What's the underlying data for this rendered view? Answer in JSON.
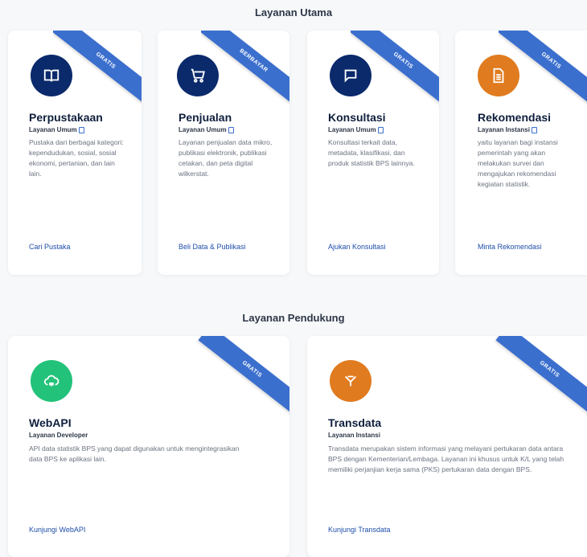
{
  "sections": {
    "utama_title": "Layanan Utama",
    "pendukung_title": "Layanan Pendukung"
  },
  "cards": [
    {
      "title": "Perpustakaan",
      "subtitle": "Layanan Umum",
      "description": "Pustaka dari berbagai kategori: kependudukan, sosial, sosial ekonomi, pertanian, dan lain lain.",
      "link": "Cari Pustaka",
      "ribbon": "GRATIS",
      "icon": "book-icon",
      "icon_color": "#0b2a6b"
    },
    {
      "title": "Penjualan",
      "subtitle": "Layanan Umum",
      "description": "Layanan penjualan data mikro, publikasi elektronik, publikasi cetakan, dan peta digital wilkerstat.",
      "link": "Beli Data & Publikasi",
      "ribbon": "BERBAYAR",
      "icon": "cart-icon",
      "icon_color": "#0b2a6b"
    },
    {
      "title": "Konsultasi",
      "subtitle": "Layanan Umum",
      "description": "Konsultasi terkait data, metadata, klasifikasi, dan produk statistik BPS lainnya.",
      "link": "Ajukan Konsultasi",
      "ribbon": "GRATIS",
      "icon": "chat-icon",
      "icon_color": "#0b2a6b"
    },
    {
      "title": "Rekomendasi",
      "subtitle": "Layanan Instansi",
      "description": "yaitu layanan bagi instansi pemerintah yang akan melakukan survei dan mengajukan rekomendasi kegiatan statistik.",
      "link": "Minta Rekomendasi",
      "ribbon": "GRATIS",
      "icon": "document-icon",
      "icon_color": "#e07b1f"
    },
    {
      "title": "WebAPI",
      "subtitle": "Layanan Developer",
      "description": "API data statistik BPS yang dapat digunakan untuk mengintegrasikan data BPS ke aplikasi lain.",
      "link": "Kunjungi WebAPI",
      "ribbon": "GRATIS",
      "icon": "cloud-icon",
      "icon_color": "#22c27a"
    },
    {
      "title": "Transdata",
      "subtitle": "Layanan Instansi",
      "description": "Transdata merupakan sistem informasi yang melayani pertukaran data antara BPS dengan Kementerian/Lembaga. Layanan ini khusus untuk K/L yang telah memiliki perjanjian kerja sama (PKS) pertukaran data dengan BPS.",
      "link": "Kunjungi Transdata",
      "ribbon": "GRATIS",
      "icon": "transfer-icon",
      "icon_color": "#e07b1f"
    }
  ]
}
